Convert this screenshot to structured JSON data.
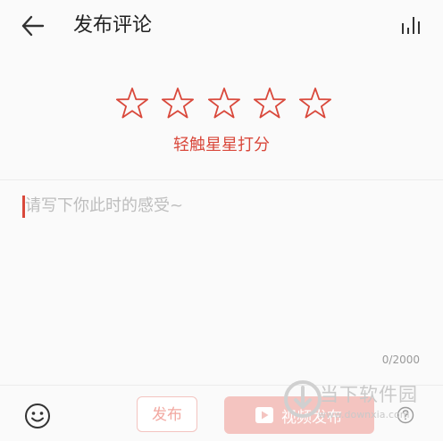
{
  "header": {
    "title": "发布评论",
    "back_icon": "arrow-left-icon",
    "stats_icon": "bar-chart-icon"
  },
  "rating": {
    "stars_total": 5,
    "stars_selected": 0,
    "star_icon": "star-outline-icon",
    "hint": "轻触星星打分"
  },
  "comment": {
    "placeholder": "请写下你此时的感受~",
    "value": "",
    "counter": "0/2000"
  },
  "toolbar": {
    "emoji_icon": "smiley-icon",
    "publish_label": "发布",
    "video_icon": "play-icon",
    "video_publish_label": "视频发布",
    "help_icon": "question-icon"
  },
  "watermark": {
    "name": "当下软件园",
    "url": "www.downxia.com"
  },
  "colors": {
    "accent": "#d9483b",
    "publish_disabled_text": "#f2a8a1",
    "video_button_bg": "#f4c4c0",
    "background": "#fafafa"
  }
}
